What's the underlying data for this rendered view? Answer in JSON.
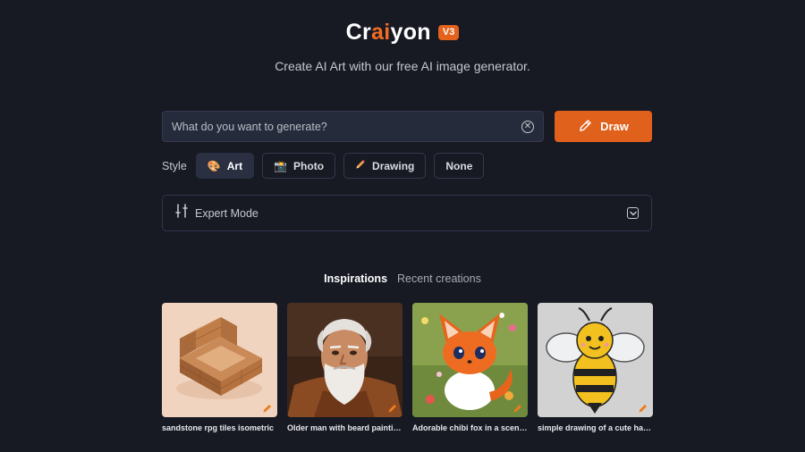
{
  "header": {
    "logo_pre": "Cr",
    "logo_ai": "ai",
    "logo_post": "yon",
    "version": "V3",
    "tagline": "Create AI Art with our free AI image generator."
  },
  "search": {
    "placeholder": "What do you want to generate?",
    "value": "",
    "clear_icon": "close-circle-icon",
    "draw_label": "Draw",
    "draw_icon": "pencil-icon"
  },
  "styles": {
    "label": "Style",
    "options": [
      {
        "label": "Art",
        "icon": "palette-icon",
        "active": true
      },
      {
        "label": "Photo",
        "icon": "camera-icon",
        "active": false
      },
      {
        "label": "Drawing",
        "icon": "pencil-icon",
        "active": false
      },
      {
        "label": "None",
        "icon": "",
        "active": false
      }
    ]
  },
  "expert": {
    "label": "Expert Mode",
    "icon": "sliders-icon",
    "toggle_icon": "chevron-down-icon"
  },
  "tabs": [
    {
      "label": "Inspirations",
      "active": true
    },
    {
      "label": "Recent creations",
      "active": false
    }
  ],
  "gallery": [
    {
      "caption": "sandstone rpg tiles isometric"
    },
    {
      "caption": "Older man with beard painting..."
    },
    {
      "caption": "Adorable chibi fox in a scenic..."
    },
    {
      "caption": "simple drawing of a cute happ..."
    }
  ],
  "colors": {
    "background": "#171923",
    "accent": "#e0611c",
    "input_bg": "#262b3b"
  }
}
